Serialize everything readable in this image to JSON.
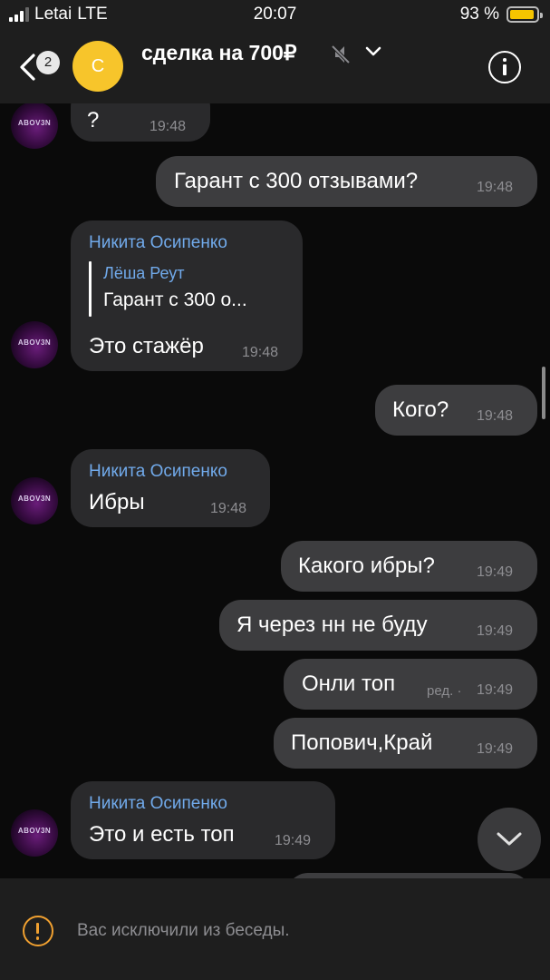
{
  "status_bar": {
    "carrier": "Letai",
    "network": "LTE",
    "time": "20:07",
    "battery": "93 %",
    "battery_level": 0.93
  },
  "header": {
    "unread_badge": "2",
    "avatar_letter": "С",
    "title": "сделка на 700₽",
    "muted": true
  },
  "avatar_label": "ABOV3N",
  "messages": [
    {
      "text": "?",
      "time": "19:48"
    },
    {
      "text": "Гарант с 300 отзывами?",
      "time": "19:48"
    },
    {
      "sender": "Никита Осипенко",
      "reply_author": "Лёша Реут",
      "reply_text": "Гарант с 300 о...",
      "text": "Это стажёр",
      "time": "19:48"
    },
    {
      "text": "Кого?",
      "time": "19:48"
    },
    {
      "sender": "Никита Осипенко",
      "text": "Ибры",
      "time": "19:48"
    },
    {
      "text": "Какого ибры?",
      "time": "19:49"
    },
    {
      "text": "Я через нн не буду",
      "time": "19:49"
    },
    {
      "text": "Онли топ",
      "edited": "ред. ·",
      "time": "19:49"
    },
    {
      "text": "Попович,Край",
      "time": "19:49"
    },
    {
      "sender": "Никита Осипенко",
      "text": "Это и есть топ",
      "time": "19:49"
    }
  ],
  "footer": {
    "notice": "Вас исключили из беседы."
  },
  "colors": {
    "accent_blue": "#71aaeb",
    "warning": "#f0a030",
    "avatar_yellow": "#f7c52b",
    "battery": "#f5c400"
  }
}
